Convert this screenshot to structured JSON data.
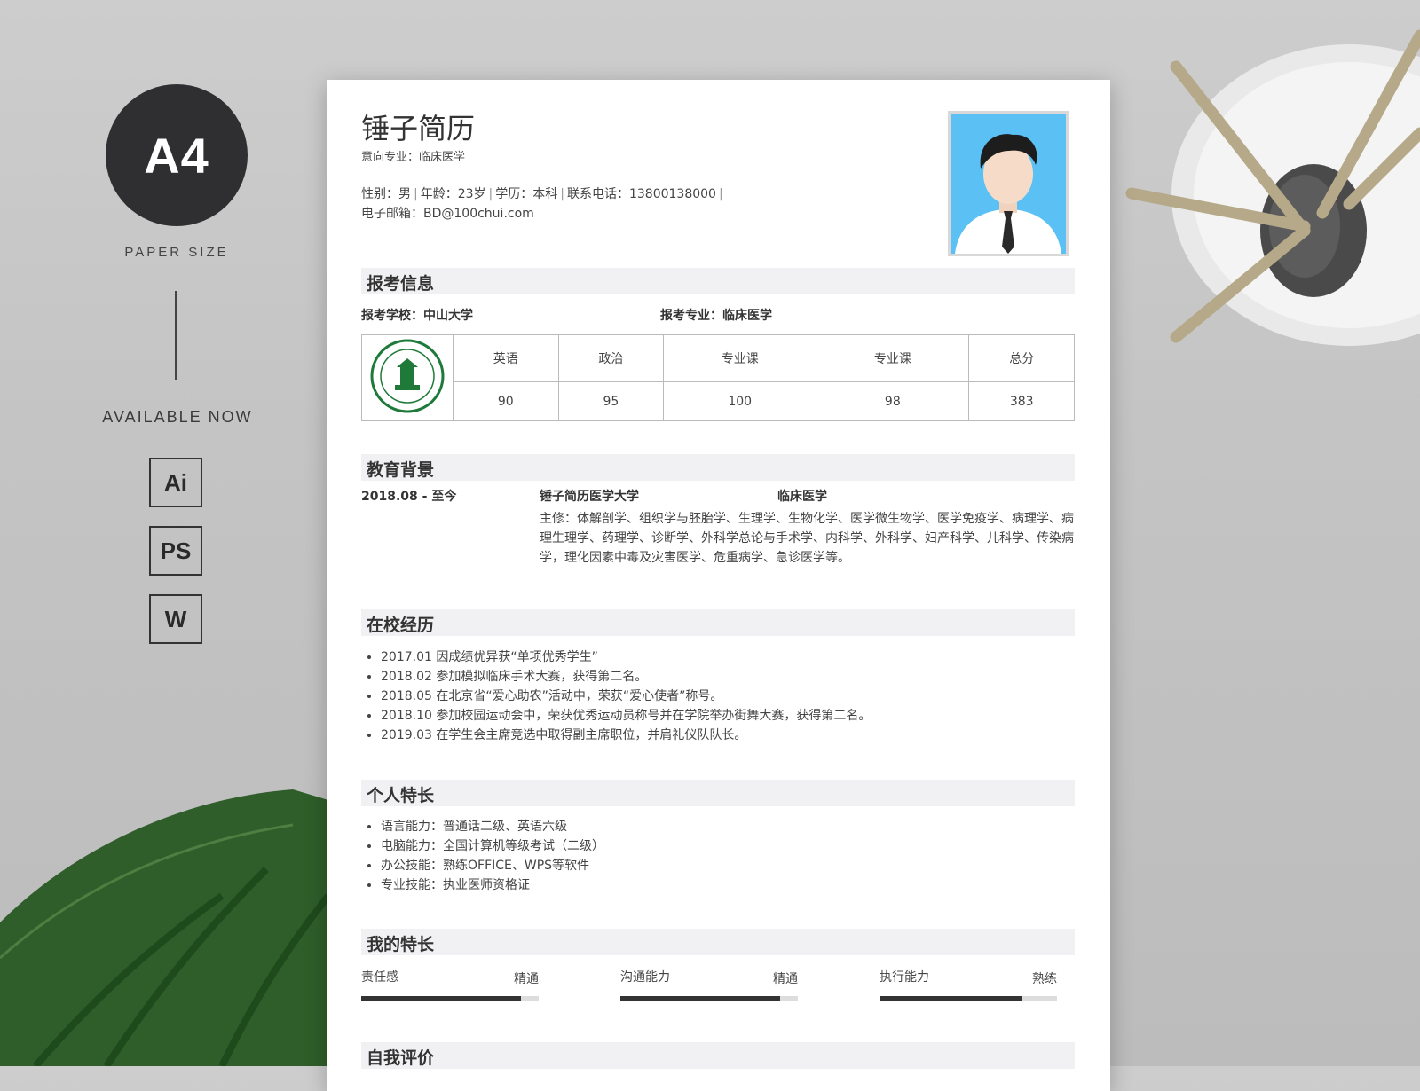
{
  "promo": {
    "badge": "A4",
    "paper_size": "PAPER SIZE",
    "available": "AVAILABLE NOW",
    "formats": [
      "Ai",
      "PS",
      "W"
    ]
  },
  "header": {
    "name": "锤子简历",
    "intent": "意向专业：临床医学",
    "gender": "性别：男",
    "age": "年龄：23岁",
    "education": "学历：本科",
    "phone": "联系电话：13800138000",
    "email": "电子邮箱：BD@100chui.com"
  },
  "exam": {
    "title": "报考信息",
    "school": "报考学校：中山大学",
    "major": "报考专业：临床医学",
    "columns": [
      "英语",
      "政治",
      "专业课",
      "专业课",
      "总分"
    ],
    "scores": [
      "90",
      "95",
      "100",
      "98",
      "383"
    ]
  },
  "education": {
    "title": "教育背景",
    "period": "2018.08 - 至今",
    "school": "锤子简历医学大学",
    "major": "临床医学",
    "courses": "主修：体解剖学、组织学与胚胎学、生理学、生物化学、医学微生物学、医学免疫学、病理学、病理生理学、药理学、诊断学、外科学总论与手术学、内科学、外科学、妇产科学、儿科学、传染病学，理化因素中毒及灾害医学、危重病学、急诊医学等。"
  },
  "campus": {
    "title": "在校经历",
    "items": [
      "2017.01 因成绩优异获“单项优秀学生”",
      "2018.02 参加模拟临床手术大赛，获得第二名。",
      "2018.05 在北京省“爱心助农”活动中，荣获“爱心使者”称号。",
      "2018.10 参加校园运动会中，荣获优秀运动员称号并在学院举办街舞大赛，获得第二名。",
      "2019.03 在学生会主席竞选中取得副主席职位，并肩礼仪队队长。"
    ]
  },
  "talents": {
    "title": "个人特长",
    "items": [
      "语言能力：普通话二级、英语六级",
      "电脑能力：全国计算机等级考试（二级）",
      "办公技能：熟练OFFICE、WPS等软件",
      "专业技能：执业医师资格证"
    ]
  },
  "skills": {
    "title": "我的特长",
    "items": [
      {
        "name": "责任感",
        "level": "精通",
        "value": 0.9
      },
      {
        "name": "沟通能力",
        "level": "精通",
        "value": 0.9
      },
      {
        "name": "执行能力",
        "level": "熟练",
        "value": 0.8
      }
    ]
  },
  "self_eval": {
    "title": "自我评价"
  },
  "colors": {
    "photo_bg": "#5bc1f5",
    "bar_fill": "#333333",
    "bar_track": "#dddddd",
    "section_bg": "#f1f1f3"
  }
}
